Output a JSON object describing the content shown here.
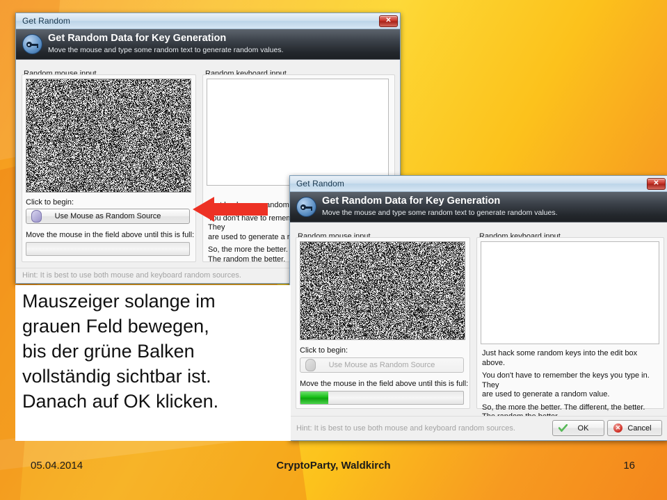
{
  "slide": {
    "footer": {
      "date": "05.04.2014",
      "title": "CryptoParty, Waldkirch",
      "page": "16"
    },
    "note": {
      "line1": "Mauszeiger solange im",
      "line2": "grauen Feld bewegen,",
      "line3": "bis der grüne Balken",
      "line4": "vollständig sichtbar ist.",
      "line5": "Danach auf OK klicken."
    },
    "arrow": {
      "name": "red-left-arrow",
      "color": "#ED3124",
      "direction": "left"
    },
    "colors": {
      "background_start": "#F79A1E",
      "background_mid": "#FDD835",
      "background_end": "#F4871C",
      "accent_green": "#17BF17",
      "accent_red": "#CF2C22"
    }
  },
  "dialog1": {
    "title": "Get Random",
    "close_label": "✕",
    "banner": {
      "heading": "Get Random Data for Key Generation",
      "subheading": "Move the mouse and type some random text to generate random values."
    },
    "mouse_group_label": "Random mouse input",
    "keyboard_group_label": "Random keyboard input",
    "click_to_begin_label": "Click to begin:",
    "use_mouse_button": "Use Mouse as Random Source",
    "move_mouse_label": "Move the mouse in the field above until this is full:",
    "progress_percent": 0,
    "keyboard_value": "",
    "keyboard_help": [
      "Just hack some random keys into the edit box above.",
      "You don't have to remember the keys you type in. They",
      "are used to generate a random value.",
      "So, the more the better. The different, the better.",
      "The random the better."
    ],
    "hint": "Hint: It is best to use both mouse and keyboard random sources."
  },
  "dialog2": {
    "title": "Get Random",
    "close_label": "✕",
    "banner": {
      "heading": "Get Random Data for Key Generation",
      "subheading": "Move the mouse and type some random text to generate random values."
    },
    "mouse_group_label": "Random mouse input",
    "keyboard_group_label": "Random keyboard input",
    "click_to_begin_label": "Click to begin:",
    "use_mouse_button": "Use Mouse as Random Source",
    "use_mouse_button_disabled": true,
    "move_mouse_label": "Move the mouse in the field above until this is full:",
    "progress_percent": 17,
    "keyboard_value": "",
    "keyboard_help": [
      "Just hack some random keys into the edit box above.",
      "You don't have to remember the keys you type in. They",
      "are used to generate a random value.",
      "So, the more the better. The different, the better.",
      "The random the better."
    ],
    "hint": "Hint: It is best to use both mouse and keyboard random sources.",
    "ok_button": "OK",
    "cancel_button": "Cancel"
  }
}
